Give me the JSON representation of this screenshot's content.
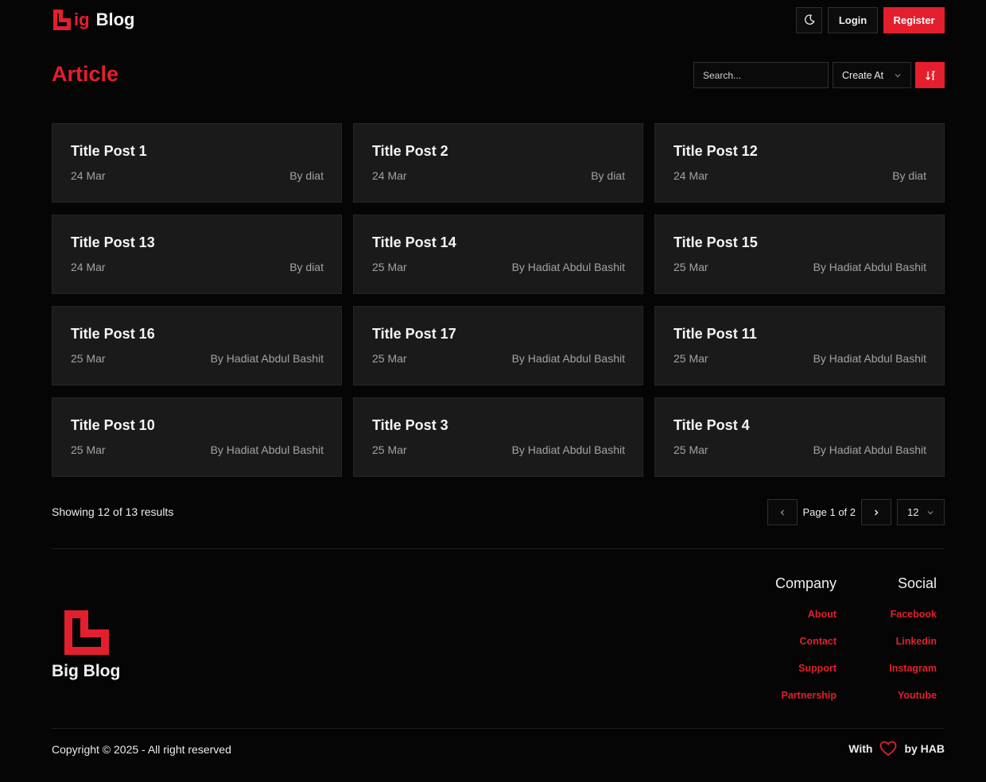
{
  "header": {
    "logo_letter": "ig",
    "logo_word": "Blog",
    "theme_icon": "moon-icon",
    "login_label": "Login",
    "register_label": "Register"
  },
  "page": {
    "title": "Article",
    "search_placeholder": "Search...",
    "sort_field": "Create At",
    "sort_icon": "sort-desc-icon"
  },
  "posts": [
    {
      "title": "Title Post 1",
      "date": "24 Mar",
      "author": "By diat"
    },
    {
      "title": "Title Post 2",
      "date": "24 Mar",
      "author": "By diat"
    },
    {
      "title": "Title Post 12",
      "date": "24 Mar",
      "author": "By diat"
    },
    {
      "title": "Title Post 13",
      "date": "24 Mar",
      "author": "By diat"
    },
    {
      "title": "Title Post 14",
      "date": "25 Mar",
      "author": "By Hadiat Abdul Bashit"
    },
    {
      "title": "Title Post 15",
      "date": "25 Mar",
      "author": "By Hadiat Abdul Bashit"
    },
    {
      "title": "Title Post 16",
      "date": "25 Mar",
      "author": "By Hadiat Abdul Bashit"
    },
    {
      "title": "Title Post 17",
      "date": "25 Mar",
      "author": "By Hadiat Abdul Bashit"
    },
    {
      "title": "Title Post 11",
      "date": "25 Mar",
      "author": "By Hadiat Abdul Bashit"
    },
    {
      "title": "Title Post 10",
      "date": "25 Mar",
      "author": "By Hadiat Abdul Bashit"
    },
    {
      "title": "Title Post 3",
      "date": "25 Mar",
      "author": "By Hadiat Abdul Bashit"
    },
    {
      "title": "Title Post 4",
      "date": "25 Mar",
      "author": "By Hadiat Abdul Bashit"
    }
  ],
  "pagination": {
    "results_text": "Showing 12 of 13 results",
    "page_label": "Page 1 of 2",
    "page_size": "12"
  },
  "footer": {
    "logo_text": "Big Blog",
    "company": {
      "title": "Company",
      "links": [
        "About",
        "Contact",
        "Support",
        "Partnership"
      ]
    },
    "social": {
      "title": "Social",
      "links": [
        "Facebook",
        "Linkedin",
        "Instagram",
        "Youtube"
      ]
    },
    "copyright": "Copyright © 2025 - All right reserved",
    "with_label": "With",
    "by_label": "by HAB"
  },
  "colors": {
    "accent": "#e31f2d",
    "background": "#050505",
    "card": "#1a1a1a"
  }
}
